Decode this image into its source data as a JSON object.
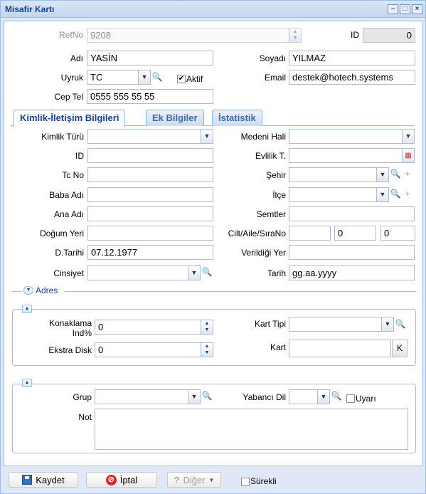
{
  "window": {
    "title": "Misafir Kartı"
  },
  "top": {
    "refno_label": "RefNo",
    "refno_value": "9208",
    "id_label": "ID",
    "id_value": "0",
    "adi_label": "Adı",
    "adi_value": "YASİN",
    "soyadi_label": "Soyadı",
    "soyadi_value": "YILMAZ",
    "uyruk_label": "Uyruk",
    "uyruk_value": "TC",
    "aktif_label": "Aktif",
    "email_label": "Email",
    "email_value": "destek@hotech.systems",
    "ceptel_label": "Cep Tel",
    "ceptel_value": "0555 555 55 55"
  },
  "tabs": [
    {
      "label": "Kimlik-İletişim Bilgileri"
    },
    {
      "label": "Ek Bilgiler"
    },
    {
      "label": "İstatistik"
    }
  ],
  "kimlik": {
    "kimlik_turu": "Kimlik Türü",
    "medeni_hali": "Medeni Hali",
    "id": "ID",
    "evlilik": "Evlilik T.",
    "tc_no": "Tc No",
    "sehir": "Şehir",
    "baba_adi": "Baba Adı",
    "ilce": "İlçe",
    "ana_adi": "Ana Adı",
    "semtler": "Semtler",
    "dogum_yeri": "Doğum Yeri",
    "cilt": "Cilt/Aile/SıraNo",
    "cilt_aile": "0",
    "cilt_sira": "0",
    "dtarihi": "D.Tarihi",
    "dtarihi_value": "07.12.1977",
    "verildigi_yer": "Verildiği Yer",
    "cinsiyet": "Cinsiyet",
    "tarih": "Tarih",
    "tarih_value": "gg.aa.yyyy"
  },
  "adres": {
    "label": "Adres"
  },
  "konaklama": {
    "konaklama_line1": "Konaklama",
    "konaklama_line2": "Ind%",
    "konaklama_value": "0",
    "ekstra_label": "Ekstra Disk",
    "ekstra_value": "0",
    "kart_tipi_label": "Kart Tipi",
    "kart_label": "Kart",
    "kart_btn": "K"
  },
  "misc": {
    "grup_label": "Grup",
    "yabanci_label": "Yabancı Dil",
    "uyari_label": "Uyarı",
    "not_label": "Not"
  },
  "footer": {
    "kaydet": "Kaydet",
    "iptal": "İptal",
    "diger": "Diğer",
    "surekli": "Sürekli"
  }
}
